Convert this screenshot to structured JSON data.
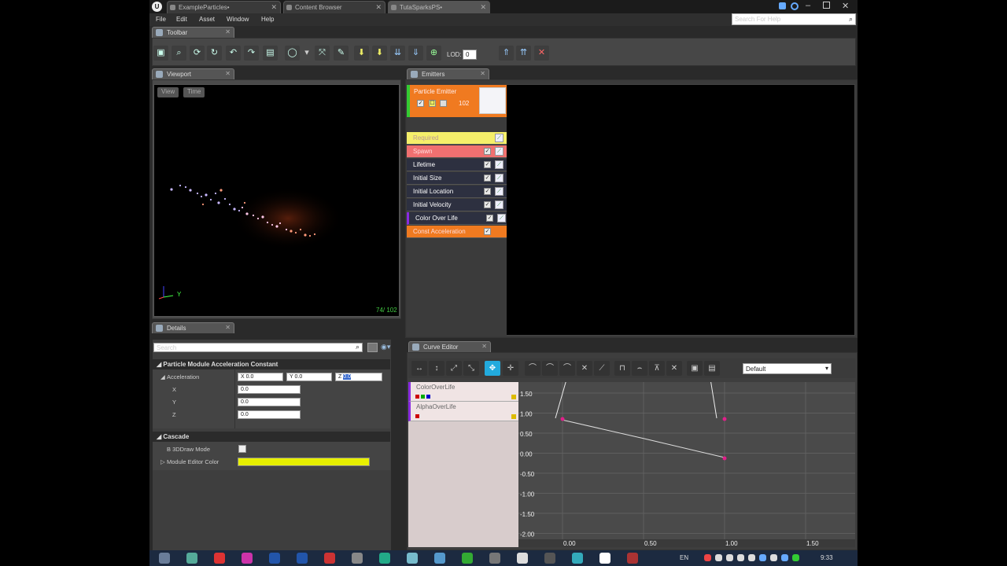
{
  "window": {
    "tabs": [
      {
        "label": "ExampleParticles•"
      },
      {
        "label": "Content Browser"
      },
      {
        "label": "TutaSparksPS•"
      }
    ],
    "logo": "U"
  },
  "menu": {
    "items": [
      "File",
      "Edit",
      "Asset",
      "Window",
      "Help"
    ],
    "help_search_placeholder": "Search For Help"
  },
  "toolbar": {
    "tab_label": "Toolbar",
    "lod_label": "LOD:",
    "lod_value": "0",
    "icons": [
      "save-icon",
      "browse-icon",
      "restart-sim-icon",
      "restart-level-icon",
      "undo-icon",
      "redo-icon",
      "thumbnail-icon",
      "bounds-icon",
      "bounds-dropdown-icon",
      "origin-axis-icon",
      "background-color-icon",
      "regen-lod-icon",
      "regen-lod-highest-icon",
      "lowest-lod-icon",
      "lower-lod-icon",
      "add-lod-icon",
      "higher-lod-icon",
      "highest-lod-icon",
      "delete-lod-icon"
    ]
  },
  "viewport": {
    "tab_label": "Viewport",
    "view_button": "View",
    "time_button": "Time",
    "counter": "74/ 102",
    "axis_label": "Y"
  },
  "emitters": {
    "tab_label": "Emitters",
    "emitter_name": "Particle Emitter",
    "emitter_count": "102",
    "modules": [
      {
        "label": "Required",
        "color": "#f5ef6a",
        "text": "#b99",
        "has_check": false
      },
      {
        "label": "Spawn",
        "color": "#f07070",
        "text": "#fdd",
        "has_check": true
      },
      {
        "label": "Lifetime",
        "color": "#2d3040",
        "text": "#fff",
        "has_check": true
      },
      {
        "label": "Initial Size",
        "color": "#2d3040",
        "text": "#fff",
        "has_check": true
      },
      {
        "label": "Initial Location",
        "color": "#2d3040",
        "text": "#fff",
        "has_check": true
      },
      {
        "label": "Initial Velocity",
        "color": "#2d3040",
        "text": "#fff",
        "has_check": true
      },
      {
        "label": "Color Over Life",
        "color": "#2d3040",
        "text": "#fff",
        "has_check": true
      },
      {
        "label": "Const Acceleration",
        "color": "#f07a20",
        "text": "#fdd",
        "has_check": true
      }
    ]
  },
  "details": {
    "tab_label": "Details",
    "search_placeholder": "Search",
    "section1_title": "Particle Module Acceleration Constant",
    "acceleration_label": "Acceleration",
    "accel_x": "X  0.0",
    "accel_y": "Y  0.0",
    "accel_z": "Z",
    "accel_z_value": "0.0",
    "x_label": "X",
    "y_label": "Y",
    "z_label": "Z",
    "x_value": "0.0",
    "y_value": "0.0",
    "z_value": "0.0",
    "section2_title": "Cascade",
    "draw_mode_label": "B 3DDraw Mode",
    "editor_color_label": "Module Editor Color",
    "editor_color": "#e8f000"
  },
  "curve_editor": {
    "tab_label": "Curve Editor",
    "preset": "Default",
    "curves": [
      {
        "label": "ColorOverLife",
        "accent": "#8a2be2"
      },
      {
        "label": "AlphaOverLife",
        "accent": "#8a2be2"
      }
    ],
    "y_ticks": [
      "1.50",
      "1.00",
      "0.50",
      "0.00",
      "-0.50",
      "-1.00",
      "-1.50",
      "-2.00"
    ],
    "x_ticks": [
      "0.00",
      "0.50",
      "1.00",
      "1.50"
    ]
  },
  "taskbar": {
    "language": "EN",
    "time": "9:33"
  }
}
